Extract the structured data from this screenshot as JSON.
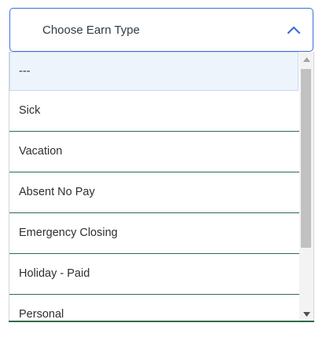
{
  "select": {
    "placeholder": "Choose Earn Type",
    "expanded_icon": "chevron-up-icon"
  },
  "options": [
    {
      "label": "---",
      "selected": true
    },
    {
      "label": "Sick"
    },
    {
      "label": "Vacation"
    },
    {
      "label": "Absent No Pay"
    },
    {
      "label": "Emergency Closing"
    },
    {
      "label": "Holiday - Paid"
    },
    {
      "label": "Personal"
    }
  ],
  "colors": {
    "accent": "#3a6fd8",
    "row_divider": "#2f6b4a",
    "selected_bg": "#eef4fb",
    "scroll_thumb": "#c1c1c1"
  },
  "scrollbar": {
    "up_icon": "scroll-up-arrow-icon",
    "down_icon": "scroll-down-arrow-icon"
  }
}
